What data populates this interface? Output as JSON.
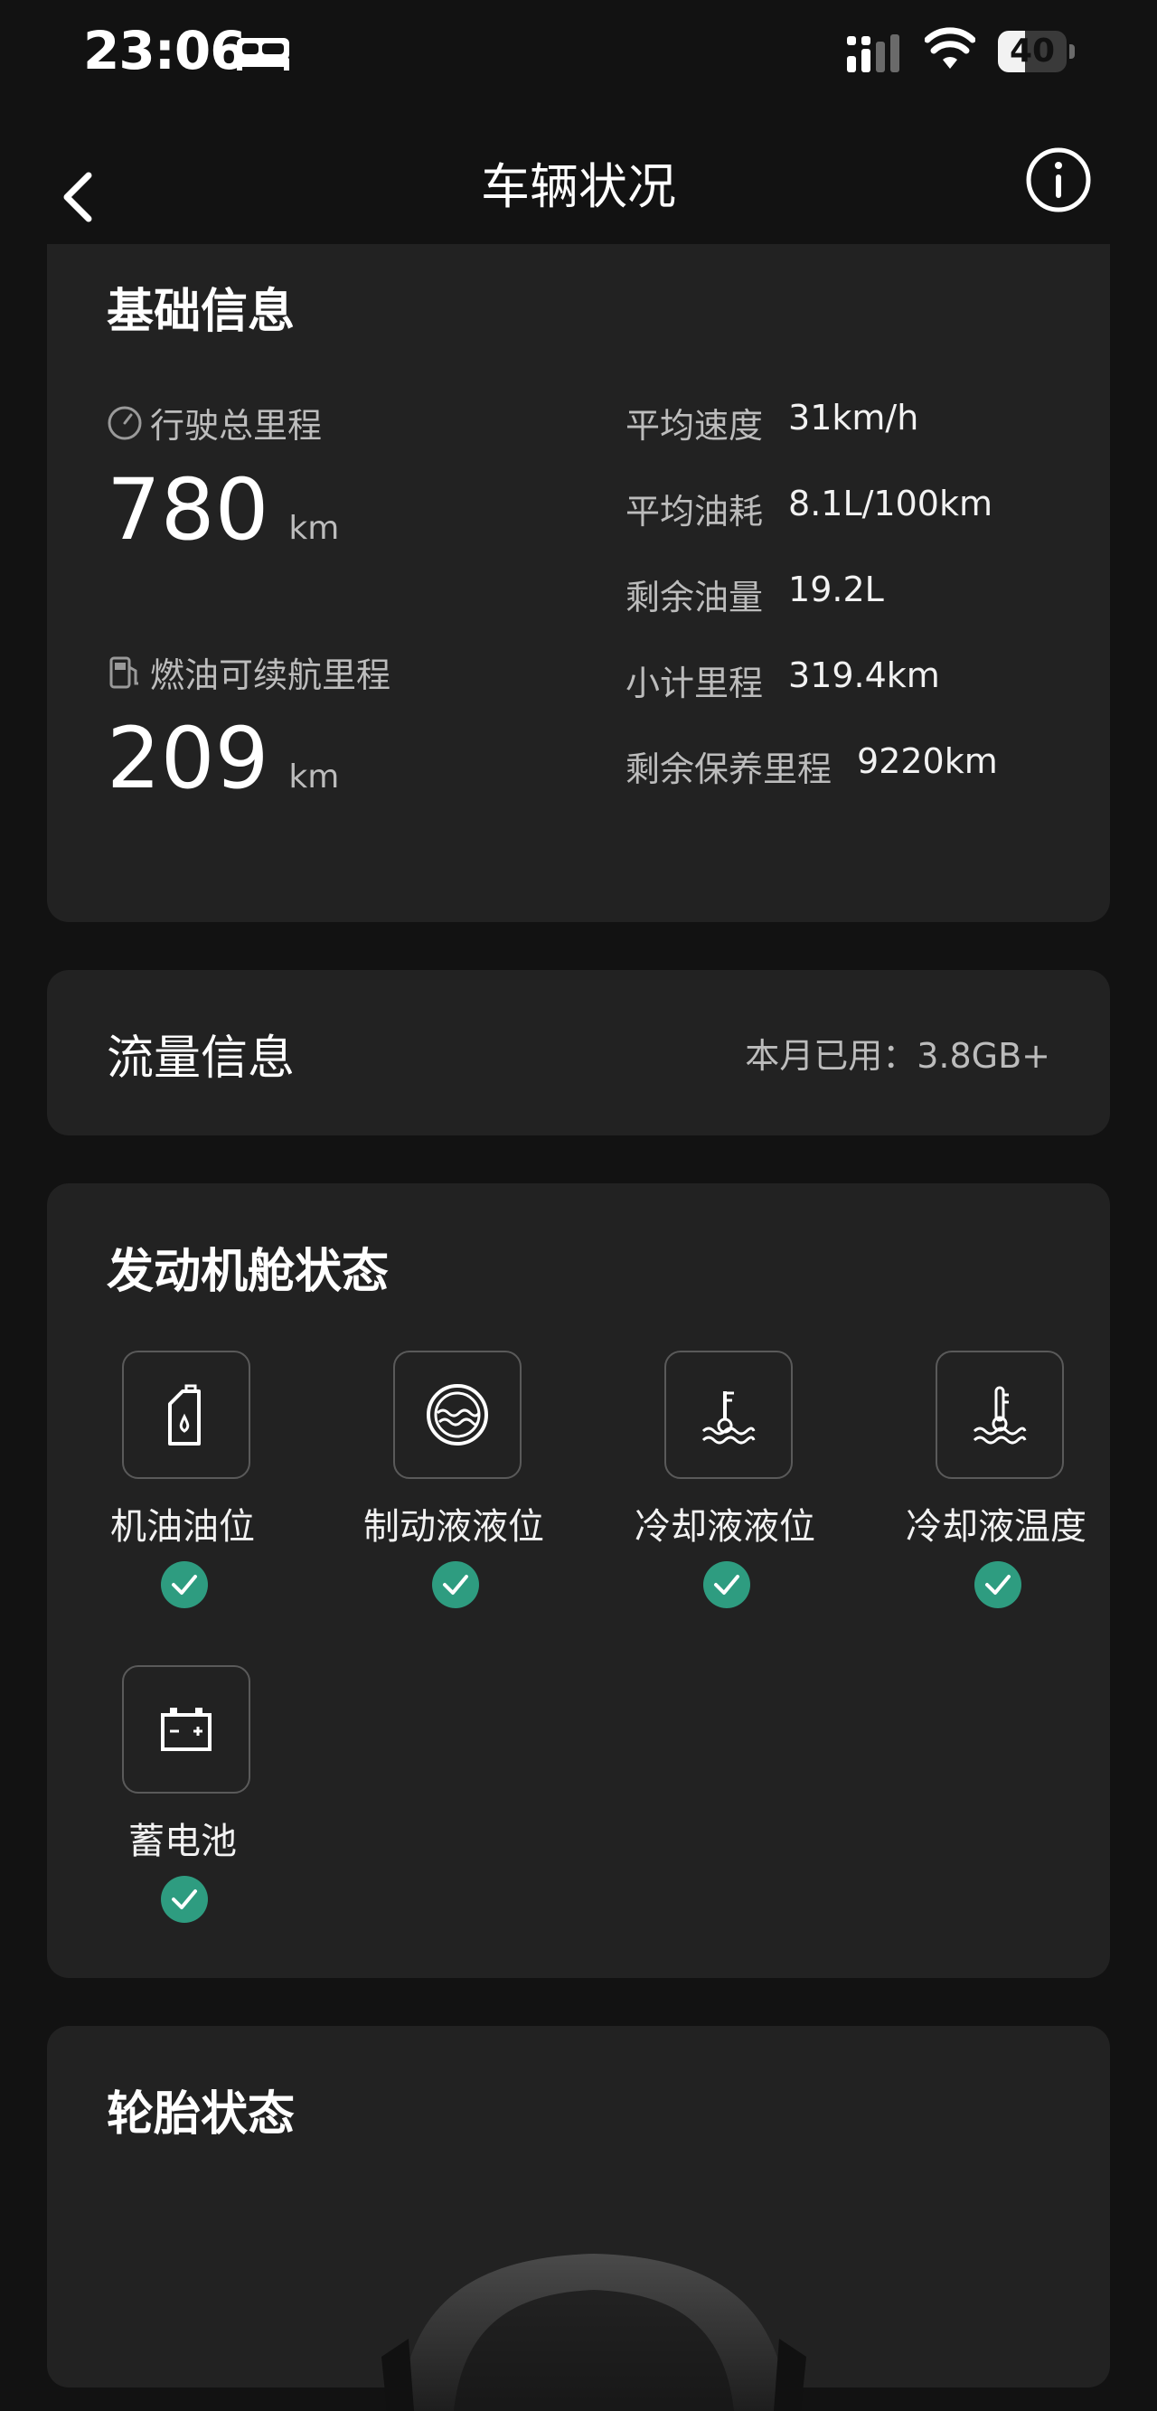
{
  "status_bar": {
    "time": "23:06",
    "battery_percent": "40",
    "battery_level": 0.4
  },
  "nav": {
    "title": "车辆状况",
    "back_icon": "chevron-left-icon",
    "info_icon": "info-circle-icon"
  },
  "basic_info": {
    "title": "基础信息",
    "total_mileage": {
      "label": "行驶总里程",
      "icon": "odometer-icon",
      "value": "780",
      "unit": "km"
    },
    "fuel_range": {
      "label": "燃油可续航里程",
      "icon": "fuel-pump-icon",
      "value": "209",
      "unit": "km"
    },
    "stats": [
      {
        "label": "平均速度",
        "value": "31km/h"
      },
      {
        "label": "平均油耗",
        "value": "8.1L/100km"
      },
      {
        "label": "剩余油量",
        "value": "19.2L"
      },
      {
        "label": "小计里程",
        "value": "319.4km"
      },
      {
        "label": "剩余保养里程",
        "value": "9220km"
      }
    ]
  },
  "data_info": {
    "title": "流量信息",
    "usage": "本月已用：3.8GB+"
  },
  "engine": {
    "title": "发动机舱状态",
    "items": [
      {
        "label": "机油油位",
        "icon": "oil-can-icon",
        "status": "ok"
      },
      {
        "label": "制动液液位",
        "icon": "brake-fluid-icon",
        "status": "ok"
      },
      {
        "label": "冷却液液位",
        "icon": "coolant-level-icon",
        "status": "ok"
      },
      {
        "label": "冷却液温度",
        "icon": "coolant-temp-icon",
        "status": "ok"
      },
      {
        "label": "蓄电池",
        "icon": "battery-icon",
        "status": "ok"
      }
    ]
  },
  "tire": {
    "title": "轮胎状态"
  },
  "colors": {
    "background": "#121212",
    "card": "#222222",
    "accent_ok": "#2e9c80"
  }
}
